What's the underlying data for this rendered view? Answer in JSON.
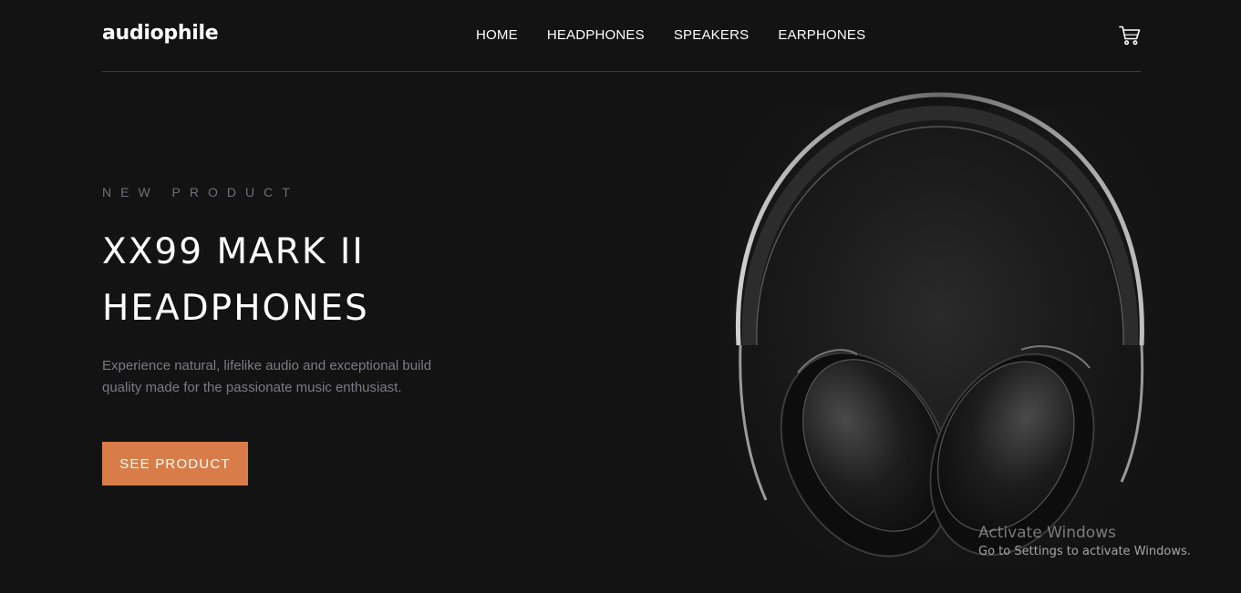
{
  "header": {
    "logo": "audiophile",
    "nav": [
      {
        "label": "HOME"
      },
      {
        "label": "HEADPHONES"
      },
      {
        "label": "SPEAKERS"
      },
      {
        "label": "EARPHONES"
      }
    ],
    "cart_icon": "cart-icon"
  },
  "hero": {
    "overline": "NEW PRODUCT",
    "title_line1": "XX99 MARK II",
    "title_line2": "HEADPHONES",
    "description": "Experience natural, lifelike audio and exceptional build quality made for the passionate music enthusiast.",
    "cta_label": "SEE PRODUCT",
    "image_icon": "headphones-image"
  },
  "watermark": {
    "title": "Activate Windows",
    "subtitle": "Go to Settings to activate Windows."
  },
  "colors": {
    "background": "#131313",
    "accent": "#d87d4a",
    "muted_text": "#7b7b85"
  }
}
